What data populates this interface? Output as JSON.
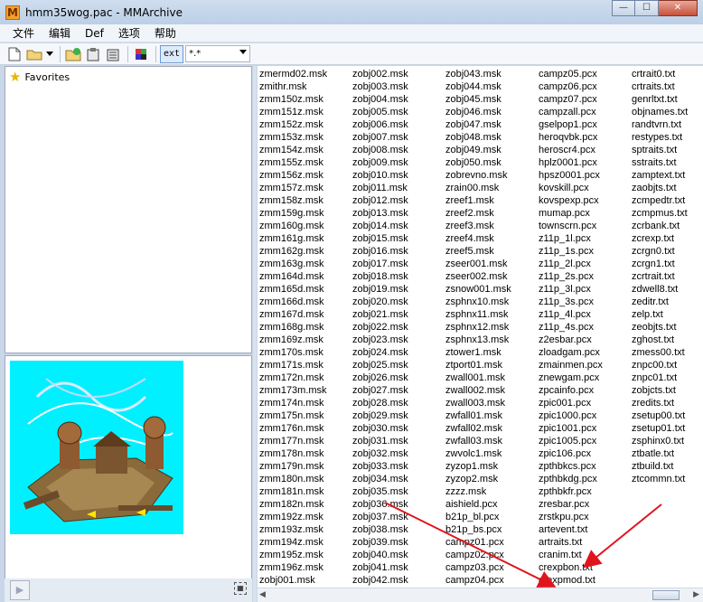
{
  "window": {
    "title": "hmm35wog.pac - MMArchive",
    "app_icon": "M",
    "controls": {
      "minimize": "—",
      "maximize": "☐",
      "close": "✕"
    }
  },
  "menu": [
    "文件",
    "编辑",
    "Def",
    "选项",
    "帮助"
  ],
  "toolbar": {
    "ext_label": "ext",
    "filter_value": "*.*",
    "icons": [
      "new-file-icon",
      "open-folder-icon",
      "add-files-icon",
      "extract-icon",
      "extract-all-icon",
      "cube-icon"
    ]
  },
  "tree": {
    "favorites_label": "Favorites"
  },
  "file_columns": [
    [
      "zmermd02.msk",
      "zmithr.msk",
      "zmm150z.msk",
      "zmm151z.msk",
      "zmm152z.msk",
      "zmm153z.msk",
      "zmm154z.msk",
      "zmm155z.msk",
      "zmm156z.msk",
      "zmm157z.msk",
      "zmm158z.msk",
      "zmm159g.msk",
      "zmm160g.msk",
      "zmm161g.msk",
      "zmm162g.msk",
      "zmm163g.msk",
      "zmm164d.msk",
      "zmm165d.msk",
      "zmm166d.msk",
      "zmm167d.msk",
      "zmm168g.msk",
      "zmm169z.msk",
      "zmm170s.msk",
      "zmm171s.msk",
      "zmm172n.msk",
      "zmm173m.msk",
      "zmm174n.msk",
      "zmm175n.msk",
      "zmm176n.msk",
      "zmm177n.msk",
      "zmm178n.msk",
      "zmm179n.msk",
      "zmm180n.msk",
      "zmm181n.msk",
      "zmm182n.msk",
      "zmm192z.msk",
      "zmm193z.msk",
      "zmm194z.msk",
      "zmm195z.msk",
      "zmm196z.msk",
      "zobj001.msk"
    ],
    [
      "zobj002.msk",
      "zobj003.msk",
      "zobj004.msk",
      "zobj005.msk",
      "zobj006.msk",
      "zobj007.msk",
      "zobj008.msk",
      "zobj009.msk",
      "zobj010.msk",
      "zobj011.msk",
      "zobj012.msk",
      "zobj013.msk",
      "zobj014.msk",
      "zobj015.msk",
      "zobj016.msk",
      "zobj017.msk",
      "zobj018.msk",
      "zobj019.msk",
      "zobj020.msk",
      "zobj021.msk",
      "zobj022.msk",
      "zobj023.msk",
      "zobj024.msk",
      "zobj025.msk",
      "zobj026.msk",
      "zobj027.msk",
      "zobj028.msk",
      "zobj029.msk",
      "zobj030.msk",
      "zobj031.msk",
      "zobj032.msk",
      "zobj033.msk",
      "zobj034.msk",
      "zobj035.msk",
      "zobj036.msk",
      "zobj037.msk",
      "zobj038.msk",
      "zobj039.msk",
      "zobj040.msk",
      "zobj041.msk",
      "zobj042.msk"
    ],
    [
      "zobj043.msk",
      "zobj044.msk",
      "zobj045.msk",
      "zobj046.msk",
      "zobj047.msk",
      "zobj048.msk",
      "zobj049.msk",
      "zobj050.msk",
      "zobrevno.msk",
      "zrain00.msk",
      "zreef1.msk",
      "zreef2.msk",
      "zreef3.msk",
      "zreef4.msk",
      "zreef5.msk",
      "zseer001.msk",
      "zseer002.msk",
      "zsnow001.msk",
      "zsphnx10.msk",
      "zsphnx11.msk",
      "zsphnx12.msk",
      "zsphnx13.msk",
      "ztower1.msk",
      "ztport01.msk",
      "zwall001.msk",
      "zwall002.msk",
      "zwall003.msk",
      "zwfall01.msk",
      "zwfall02.msk",
      "zwfall03.msk",
      "zwvolc1.msk",
      "zyzop1.msk",
      "zyzop2.msk",
      "zzzz.msk",
      "aishield.pcx",
      "b21p_bl.pcx",
      "b21p_bs.pcx",
      "campz01.pcx",
      "campz02.pcx",
      "campz03.pcx",
      "campz04.pcx"
    ],
    [
      "campz05.pcx",
      "campz06.pcx",
      "campz07.pcx",
      "campzall.pcx",
      "gselpop1.pcx",
      "heroqvbk.pcx",
      "heroscr4.pcx",
      "hplz0001.pcx",
      "hpsz0001.pcx",
      "kovskill.pcx",
      "kovspexp.pcx",
      "mumap.pcx",
      "townscrn.pcx",
      "z11p_1l.pcx",
      "z11p_1s.pcx",
      "z11p_2l.pcx",
      "z11p_2s.pcx",
      "z11p_3l.pcx",
      "z11p_3s.pcx",
      "z11p_4l.pcx",
      "z11p_4s.pcx",
      "z2esbar.pcx",
      "zloadgam.pcx",
      "zmainmen.pcx",
      "znewgam.pcx",
      "zpcainfo.pcx",
      "zpic001.pcx",
      "zpic1000.pcx",
      "zpic1001.pcx",
      "zpic1005.pcx",
      "zpic106.pcx",
      "zpthbkcs.pcx",
      "zpthbkdg.pcx",
      "zpthbkfr.pcx",
      "zresbar.pcx",
      "zrstkpu.pcx",
      "artevent.txt",
      "artraits.txt",
      "cranim.txt",
      "crexpbon.txt",
      "crexpmod.txt"
    ],
    [
      "crtrait0.txt",
      "crtraits.txt",
      "genrltxt.txt",
      "objnames.txt",
      "randtvrn.txt",
      "restypes.txt",
      "sptraits.txt",
      "sstraits.txt",
      "zamptext.txt",
      "zaobjts.txt",
      "zcmpedtr.txt",
      "zcmpmus.txt",
      "zcrbank.txt",
      "zcrexp.txt",
      "zcrgn0.txt",
      "zcrgn1.txt",
      "zcrtrait.txt",
      "zdwell8.txt",
      "zeditr.txt",
      "zelp.txt",
      "zeobjts.txt",
      "zghost.txt",
      "zmess00.txt",
      "znpc00.txt",
      "znpc01.txt",
      "zobjcts.txt",
      "zredits.txt",
      "zsetup00.txt",
      "zsetup01.txt",
      "zsphinx0.txt",
      "ztbatle.txt",
      "ztbuild.txt",
      "ztcommn.txt"
    ]
  ],
  "colors": {
    "preview_bg": "#00f0ff",
    "annotation_arrow": "#e0141e"
  }
}
